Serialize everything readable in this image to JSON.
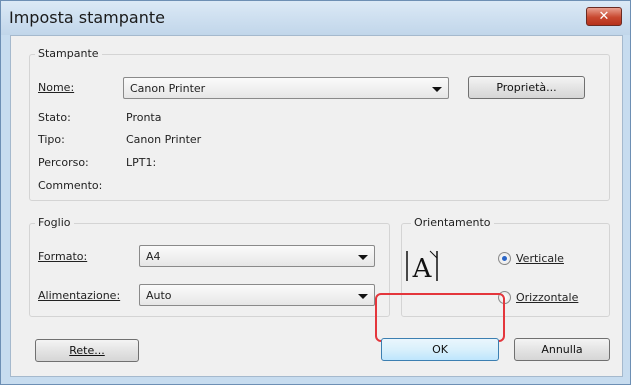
{
  "window": {
    "title": "Imposta stampante",
    "close_glyph": "✕"
  },
  "printer": {
    "group_label": "Stampante",
    "name_label": "Nome:",
    "name_value": "Canon Printer",
    "properties_button": "Proprietà...",
    "status_label": "Stato:",
    "status_value": "Pronta",
    "type_label": "Tipo:",
    "type_value": "Canon Printer",
    "path_label": "Percorso:",
    "path_value": "LPT1:",
    "comment_label": "Commento:",
    "comment_value": ""
  },
  "sheet": {
    "group_label": "Foglio",
    "format_label": "Formato:",
    "format_value": "A4",
    "feed_label": "Alimentazione:",
    "feed_value": "Auto"
  },
  "orientation": {
    "group_label": "Orientamento",
    "icon_letter": "A",
    "portrait_label": "Verticale",
    "landscape_label": "Orizzontale",
    "selected": "Verticale"
  },
  "buttons": {
    "network": "Rete...",
    "ok": "OK",
    "cancel": "Annulla"
  },
  "colors": {
    "highlight": "#e4363c",
    "close": "#c8482f"
  }
}
